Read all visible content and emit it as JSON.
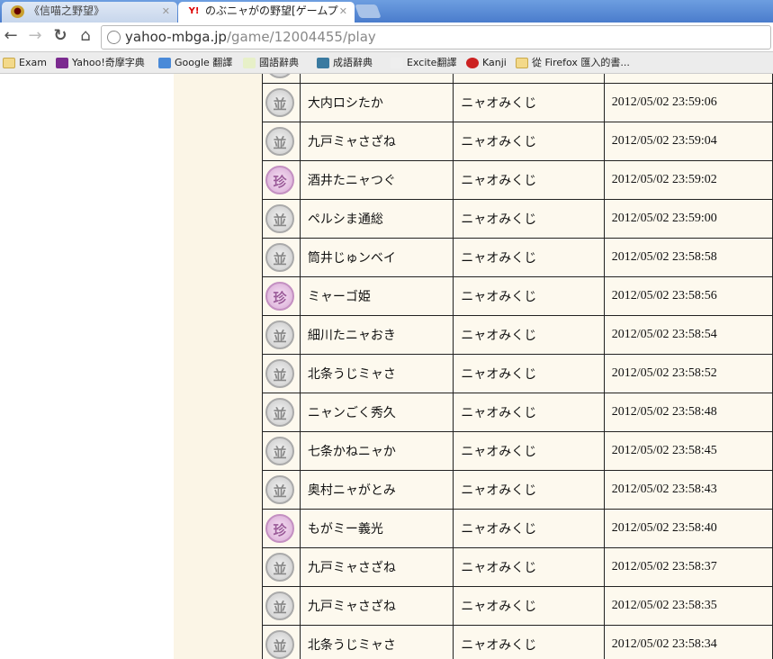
{
  "browser": {
    "tabs": [
      {
        "title": "《信喵之野望》",
        "icon": "nobunyaga-crest-icon"
      },
      {
        "title": "のぶニャがの野望[ゲームプ",
        "icon": "yahoo-icon",
        "active": true
      }
    ],
    "url_host": "yahoo-mbga.jp",
    "url_path": "/game/12004455/play",
    "bookmarks": [
      "Exam",
      "Yahoo!奇摩字典",
      "Google 翻譯",
      "國語辭典",
      "成語辭典",
      "Excite翻譯",
      "Kanji",
      "從 Firefox 匯入的書..."
    ]
  },
  "rows": [
    {
      "rank": "並",
      "name": "",
      "type": "",
      "time": ""
    },
    {
      "rank": "並",
      "name": "大内ロシたか",
      "type": "ニャオみくじ",
      "time": "2012/05/02 23:59:06"
    },
    {
      "rank": "並",
      "name": "九戸ミャさざね",
      "type": "ニャオみくじ",
      "time": "2012/05/02 23:59:04"
    },
    {
      "rank": "珍",
      "name": "酒井たニャつぐ",
      "type": "ニャオみくじ",
      "time": "2012/05/02 23:59:02"
    },
    {
      "rank": "並",
      "name": "ペルシま通総",
      "type": "ニャオみくじ",
      "time": "2012/05/02 23:59:00"
    },
    {
      "rank": "並",
      "name": "筒井じゅンベイ",
      "type": "ニャオみくじ",
      "time": "2012/05/02 23:58:58"
    },
    {
      "rank": "珍",
      "name": "ミャーゴ姫",
      "type": "ニャオみくじ",
      "time": "2012/05/02 23:58:56"
    },
    {
      "rank": "並",
      "name": "細川たニャおき",
      "type": "ニャオみくじ",
      "time": "2012/05/02 23:58:54"
    },
    {
      "rank": "並",
      "name": "北条うじミャさ",
      "type": "ニャオみくじ",
      "time": "2012/05/02 23:58:52"
    },
    {
      "rank": "並",
      "name": "ニャンごく秀久",
      "type": "ニャオみくじ",
      "time": "2012/05/02 23:58:48"
    },
    {
      "rank": "並",
      "name": "七条かねニャか",
      "type": "ニャオみくじ",
      "time": "2012/05/02 23:58:45"
    },
    {
      "rank": "並",
      "name": "奥村ニャがとみ",
      "type": "ニャオみくじ",
      "time": "2012/05/02 23:58:43"
    },
    {
      "rank": "珍",
      "name": "もがミー義光",
      "type": "ニャオみくじ",
      "time": "2012/05/02 23:58:40"
    },
    {
      "rank": "並",
      "name": "九戸ミャさざね",
      "type": "ニャオみくじ",
      "time": "2012/05/02 23:58:37"
    },
    {
      "rank": "並",
      "name": "九戸ミャさざね",
      "type": "ニャオみくじ",
      "time": "2012/05/02 23:58:35"
    },
    {
      "rank": "並",
      "name": "北条うじミャさ",
      "type": "ニャオみくじ",
      "time": "2012/05/02 23:58:34"
    }
  ]
}
